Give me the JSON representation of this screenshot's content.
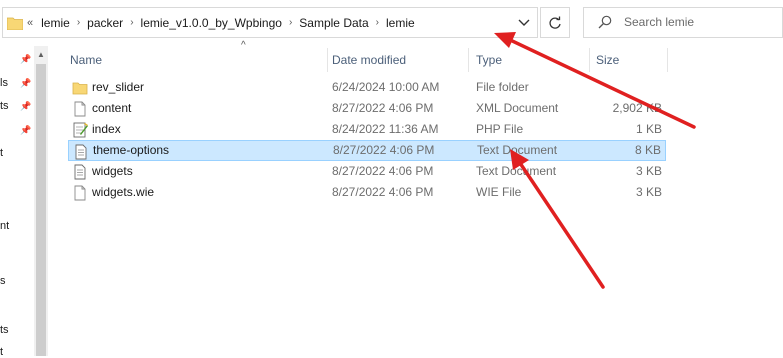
{
  "address": {
    "overflow": "«",
    "crumbs": [
      "lemie",
      "packer",
      "lemie_v1.0.0_by_Wpbingo",
      "Sample Data",
      "lemie"
    ]
  },
  "search": {
    "placeholder": "Search lemie"
  },
  "nav_fragments": [
    "ls",
    "ts",
    "t",
    "nt",
    "s",
    "ts",
    "t"
  ],
  "columns": {
    "name": "Name",
    "date": "Date modified",
    "type": "Type",
    "size": "Size"
  },
  "files": [
    {
      "name": "rev_slider",
      "date": "6/24/2024 10:00 AM",
      "type": "File folder",
      "size": "",
      "icon": "folder-icon",
      "selected": false
    },
    {
      "name": "content",
      "date": "8/27/2022 4:06 PM",
      "type": "XML Document",
      "size": "2,902 KB",
      "icon": "xml-file-icon",
      "selected": false
    },
    {
      "name": "index",
      "date": "8/24/2022 11:36 AM",
      "type": "PHP File",
      "size": "1 KB",
      "icon": "php-file-icon",
      "selected": false
    },
    {
      "name": "theme-options",
      "date": "8/27/2022 4:06 PM",
      "type": "Text Document",
      "size": "8 KB",
      "icon": "text-file-icon",
      "selected": true
    },
    {
      "name": "widgets",
      "date": "8/27/2022 4:06 PM",
      "type": "Text Document",
      "size": "3 KB",
      "icon": "text-file-icon",
      "selected": false
    },
    {
      "name": "widgets.wie",
      "date": "8/27/2022 4:06 PM",
      "type": "WIE File",
      "size": "3 KB",
      "icon": "generic-file-icon",
      "selected": false
    }
  ],
  "annotation_color": "#e02020"
}
